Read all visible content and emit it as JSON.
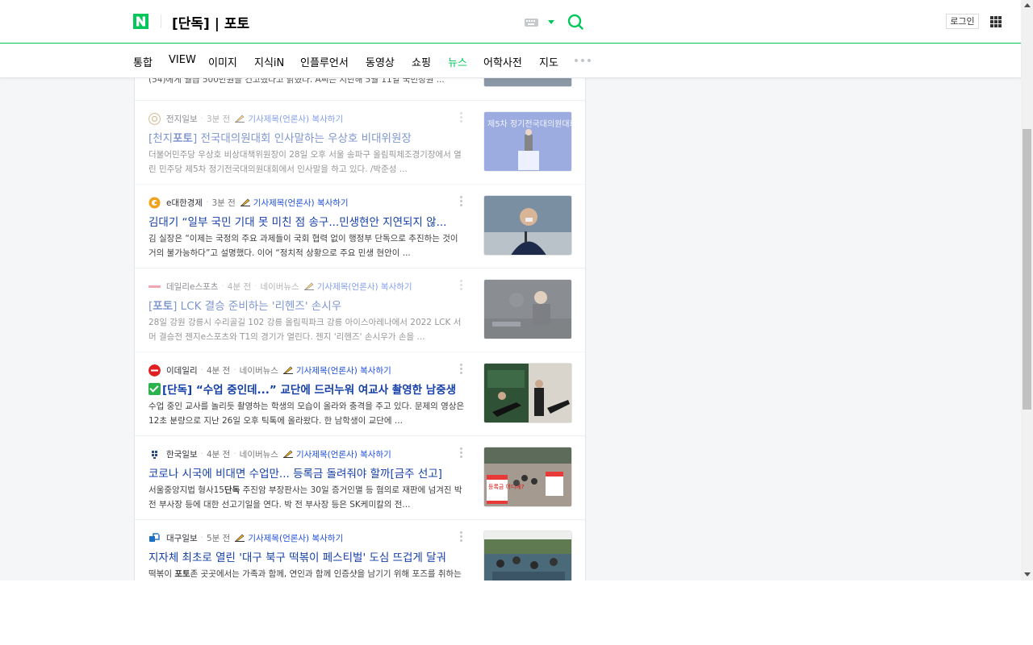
{
  "header": {
    "search_query": "[단독] | 포토",
    "login_label": "로그인"
  },
  "tabs": [
    {
      "label": "통합"
    },
    {
      "label": "VIEW"
    },
    {
      "label": "이미지"
    },
    {
      "label": "지식iN"
    },
    {
      "label": "인플루언서"
    },
    {
      "label": "동영상"
    },
    {
      "label": "쇼핑"
    },
    {
      "label": "뉴스",
      "active": true
    },
    {
      "label": "어학사전"
    },
    {
      "label": "지도"
    }
  ],
  "copy_label": "기사제목(언론사) 복사하기",
  "partial_top": {
    "desc": "(54)에게 월급 500만원을 건고했다고 밝혔다. A씨는 지난해 5월 11일 국민정원 ..."
  },
  "articles": [
    {
      "press": "전지일보",
      "time": "3분 전",
      "naver": "",
      "title": "[천지포토] 전국대의원대회 인사말하는 우상호 비대위원장",
      "desc": "더불어민주당 우상호 비상대책위원장이 28일 오후 서울 송파구 올림픽체조경기장에서 열린 민주당 제5차 정기전국대의원대회에서 인사말을 하고 있다. /박준성 ...",
      "faded": true
    },
    {
      "press": "e대한경제",
      "time": "3분 전",
      "naver": "",
      "title": "김대기 “일부 국민 기대 못 미친 점 송구...민생현안 지연되지 않...",
      "desc": "김 실장은 “이제는 국정의 주요 과제들이 국회 협력 없이 행정부 단독으로 추진하는 것이 거의 불가능하다”고 설명했다. 이어 “정치적 상황으로 주요 민생 현안이 ...",
      "faded": false
    },
    {
      "press": "데일리e스포츠",
      "time": "4분 전",
      "naver": "네이버뉴스",
      "title": "[포토] LCK 결승 준비하는 '리헨즈' 손시우",
      "desc": "28일 강원 강릉시 수리골길 102 강릉 올림픽파크 강릉 아이스아레나에서 2022 LCK 서머 결승전 젠지e스포츠와 T1의 경기가 열린다. 젠지 '리헨즈' 손시우가 손을 ...",
      "faded": true
    },
    {
      "press": "이데일리",
      "time": "4분 전",
      "naver": "네이버뉴스",
      "title": "[단독] “수업 중인데...” 교단에 드러누워 여교사 촬영한 남중생",
      "desc": "수업 중인 교사를 놀리듯 촬영하는 학생의 모습이 올라와 충격을 주고 있다. 문제의 영상은 12초 분량으로 지난 26일 오후 틱톡에 올라왔다. 한 남학생이 교단에 ...",
      "faded": false
    },
    {
      "press": "한국일보",
      "time": "4분 전",
      "naver": "네이버뉴스",
      "title": "코로나 시국에 비대면 수업만... 등록금 돌려줘야 할까[금주 선고]",
      "desc": "서울중앙지법 형사15단독 주진암 부장판사는 30일 증거인멸 등 혐의로 재판에 넘겨진 박 전 부사장 등에 대한 선고기일을 연다. 박 전 부사장 등은 SK케미칼의 전...",
      "faded": false
    },
    {
      "press": "대구일보",
      "time": "5분 전",
      "naver": "",
      "title": "지자체 최초로 열린 '대구 북구 떡볶이 페스티벌' 도심 뜨겁게 달궈",
      "desc": "떡볶이 포토존 곳곳에서는 가족과 함께, 연인과 함께 인증샷을 남기기 위해 포즈를 취하는 시민들이 많았다. ...",
      "faded": false
    }
  ],
  "thumb_texts": {
    "conference_banner": "제5차 정기전국대의원대회",
    "protest_sign": "등록금 어디에?"
  },
  "colors": {
    "brand_green": "#03c75a",
    "title_blue": "#1540a8",
    "copy_blue": "#1d4ed8"
  }
}
